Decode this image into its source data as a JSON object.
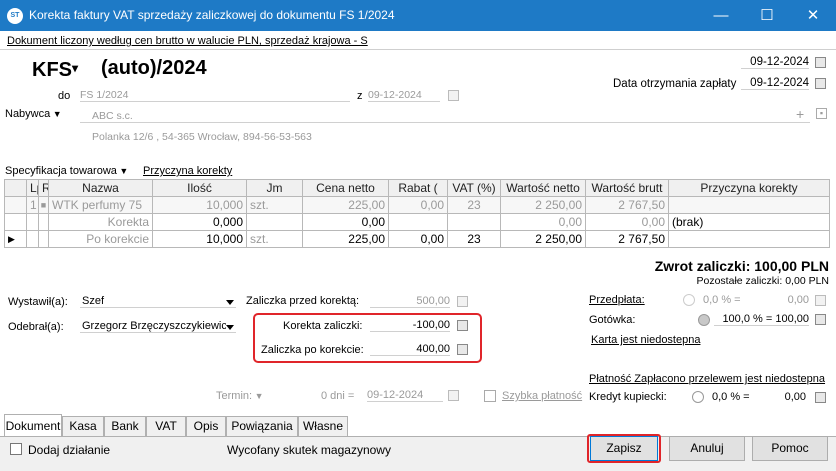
{
  "window": {
    "title": "Korekta faktury VAT sprzedaży zaliczkowej do dokumentu FS 1/2024",
    "icon_text": "ST"
  },
  "header": {
    "info_line": "Dokument liczony według cen brutto w walucie PLN, sprzedaż krajowa - S",
    "doc_type": "KFS",
    "doc_number": "(auto)/2024",
    "date_top": "09-12-2024",
    "payment_date_label": "Data otrzymania zapłaty",
    "payment_date": "09-12-2024",
    "do_label": "do",
    "do_value": "FS 1/2024",
    "z_label": "z",
    "z_value": "09-12-2024",
    "buyer_label": "Nabywca",
    "buyer_name": "ABC s.c.",
    "buyer_address": "Polanka 12/6 , 54-365 Wrocław, 894-56-53-563"
  },
  "spec": {
    "label": "Specyfikacja towarowa",
    "reason_link": "Przyczyna korekty"
  },
  "table": {
    "columns": [
      "Lp",
      "R",
      "Nazwa",
      "Ilość",
      "Jm",
      "Cena netto",
      "Rabat (",
      "VAT (%)",
      "Wartość netto",
      "Wartość brutt",
      "Przyczyna korekty"
    ],
    "rows": [
      {
        "marker": "",
        "lp": "1",
        "r": "■",
        "name": "WTK perfumy 75",
        "qty": "10,000",
        "jm": "szt.",
        "price": "225,00",
        "disc": "0,00",
        "vat": "23",
        "net": "2 250,00",
        "gross": "2 767,50",
        "reason": ""
      },
      {
        "marker": "",
        "lp": "",
        "r": "",
        "name": "Korekta",
        "qty": "0,000",
        "jm": "",
        "price": "0,00",
        "disc": "",
        "vat": "",
        "net": "0,00",
        "gross": "0,00",
        "reason": "(brak)"
      },
      {
        "marker": "▶",
        "lp": "",
        "r": "",
        "name": "Po korekcie",
        "qty": "10,000",
        "jm": "szt.",
        "price": "225,00",
        "disc": "0,00",
        "vat": "23",
        "net": "2 250,00",
        "gross": "2 767,50",
        "reason": ""
      }
    ]
  },
  "summary": {
    "refund": "Zwrot zaliczki: 100,00 PLN",
    "remaining_label": "Pozostałe zaliczki:",
    "remaining": "0,00 PLN"
  },
  "people": {
    "issued_label": "Wystawił(a):",
    "issued": "Szef",
    "received_label": "Odebrał(a):",
    "received": "Grzegorz Brzęczyszczykiewicz"
  },
  "advance": {
    "before_label": "Zaliczka przed korektą:",
    "before": "500,00",
    "correction_label": "Korekta zaliczki:",
    "correction": "-100,00",
    "after_label": "Zaliczka po korekcie:",
    "after": "400,00"
  },
  "payment": {
    "prepaid_label": "Przedpłata:",
    "prepaid_pct": "0,0 % =",
    "prepaid_amount": "0,00",
    "cash_label": "Gotówka:",
    "cash_pct": "100,0 % =",
    "cash_amount": "100,00",
    "card_link": "Karta jest niedostepna",
    "transfer_link": "Płatność Zapłacono przelewem jest niedostepna",
    "credit_label": "Kredyt kupiecki:",
    "credit_pct": "0,0 % =",
    "credit_amount": "0,00"
  },
  "term": {
    "label": "Termin:",
    "days": "0 dni =",
    "date": "09-12-2024",
    "quick_payment": "Szybka płatność"
  },
  "tabs": [
    "Dokument",
    "Kasa",
    "Bank",
    "VAT",
    "Opis",
    "Powiązania",
    "Własne"
  ],
  "footer": {
    "add_action": "Dodaj działanie",
    "stock_effect": "Wycofany skutek magazynowy",
    "save": "Zapisz",
    "cancel": "Anuluj",
    "help": "Pomoc"
  },
  "colors": {
    "titlebar": "#1e7ac6",
    "highlight": "#e0252a"
  }
}
